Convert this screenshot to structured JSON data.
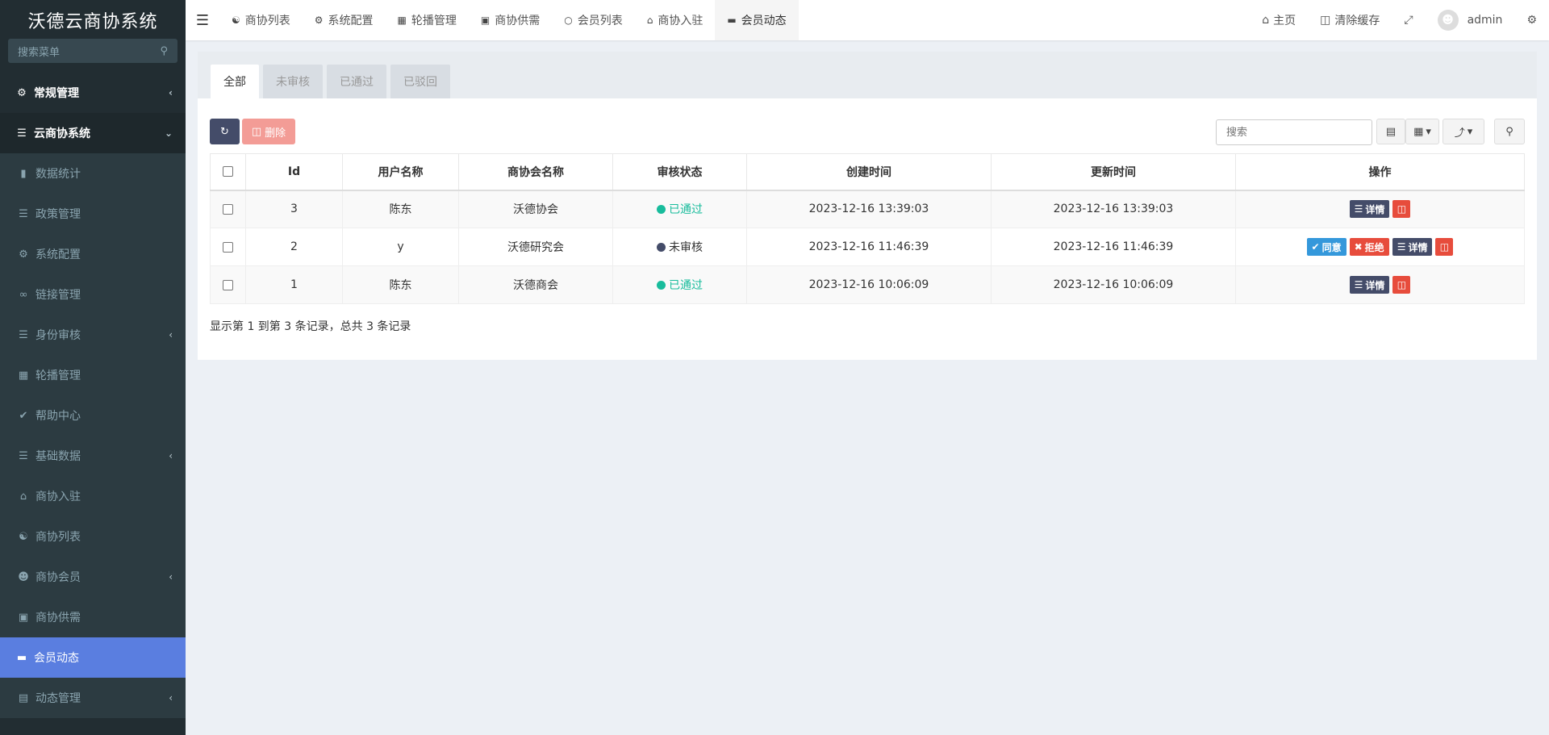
{
  "sidebar": {
    "logo": "沃德云商协系统",
    "search_placeholder": "搜索菜单",
    "items": [
      {
        "label": "常规管理",
        "icon": "cogs-icon"
      },
      {
        "label": "云商协系统",
        "icon": "list-icon"
      },
      {
        "label": "数据统计",
        "icon": "bar-chart-icon"
      },
      {
        "label": "政策管理",
        "icon": "list-icon"
      },
      {
        "label": "系统配置",
        "icon": "gear-icon"
      },
      {
        "label": "链接管理",
        "icon": "link-icon"
      },
      {
        "label": "身份审核",
        "icon": "list-icon"
      },
      {
        "label": "轮播管理",
        "icon": "grid-icon"
      },
      {
        "label": "帮助中心",
        "icon": "check-icon"
      },
      {
        "label": "基础数据",
        "icon": "database-icon"
      },
      {
        "label": "商协入驻",
        "icon": "bank-icon"
      },
      {
        "label": "商协列表",
        "icon": "handshake-icon"
      },
      {
        "label": "商协会员",
        "icon": "user-icon"
      },
      {
        "label": "商协供需",
        "icon": "shopping-bag-icon"
      },
      {
        "label": "会员动态",
        "icon": "book-icon"
      },
      {
        "label": "动态管理",
        "icon": "newspaper-icon"
      }
    ]
  },
  "topnav": {
    "tabs": [
      {
        "label": "商协列表",
        "icon": "handshake-icon"
      },
      {
        "label": "系统配置",
        "icon": "gear-icon"
      },
      {
        "label": "轮播管理",
        "icon": "grid-icon"
      },
      {
        "label": "商协供需",
        "icon": "shopping-bag-icon"
      },
      {
        "label": "会员列表",
        "icon": "circle-icon"
      },
      {
        "label": "商协入驻",
        "icon": "bank-icon"
      },
      {
        "label": "会员动态",
        "icon": "book-icon"
      }
    ],
    "home": "主页",
    "clear_cache": "清除缓存",
    "user": "admin"
  },
  "panel": {
    "tabs": [
      "全部",
      "未审核",
      "已通过",
      "已驳回"
    ],
    "delete_label": "删除",
    "search_placeholder": "搜索",
    "columns": [
      "Id",
      "用户名称",
      "商协会名称",
      "审核状态",
      "创建时间",
      "更新时间",
      "操作"
    ],
    "rows": [
      {
        "id": "3",
        "username": "陈东",
        "org": "沃德协会",
        "status": "已通过",
        "created": "2023-12-16 13:39:03",
        "updated": "2023-12-16 13:39:03"
      },
      {
        "id": "2",
        "username": "y",
        "org": "沃德研究会",
        "status": "未审核",
        "created": "2023-12-16 11:46:39",
        "updated": "2023-12-16 11:46:39"
      },
      {
        "id": "1",
        "username": "陈东",
        "org": "沃德商会",
        "status": "已通过",
        "created": "2023-12-16 10:06:09",
        "updated": "2023-12-16 10:06:09"
      }
    ],
    "actions": {
      "detail": "详情",
      "agree": "同意",
      "reject": "拒绝"
    },
    "summary": "显示第 1 到第 3 条记录，总共 3 条记录"
  },
  "colors": {
    "sidebar_bg": "#222d32",
    "active_menu": "#5a7ee0",
    "status_ok": "#18bc9c",
    "danger": "#e74c3c",
    "primary_dark": "#444c69",
    "info": "#3498db"
  }
}
